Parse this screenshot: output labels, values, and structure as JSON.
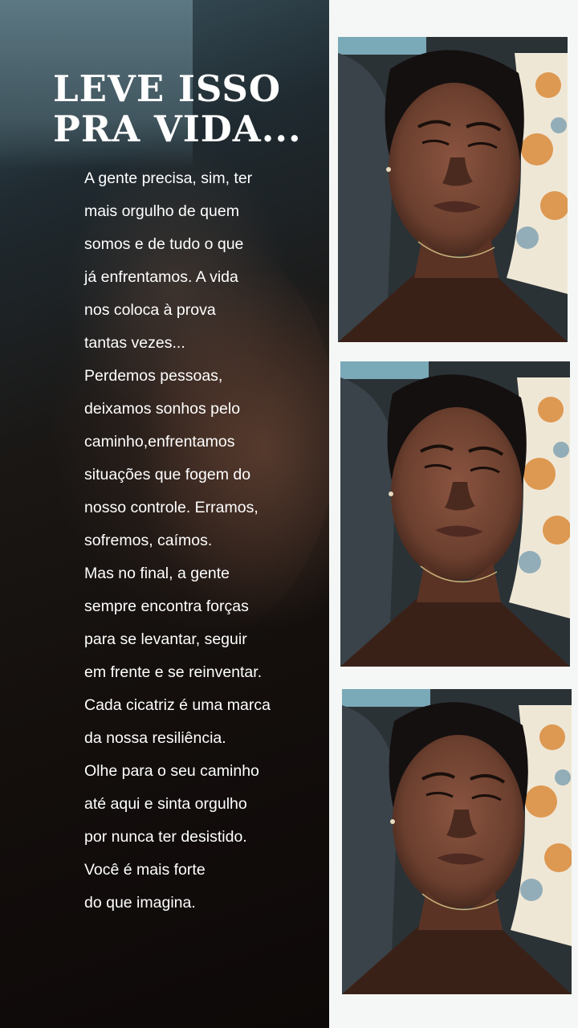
{
  "title": {
    "line1": "LEVE ISSO",
    "line2": "PRA VIDA..."
  },
  "poem": {
    "lines": [
      "A gente precisa, sim, ter",
      "mais orgulho de quem",
      "somos e de tudo o que",
      "já enfrentamos. A vida",
      "nos coloca à prova",
      "tantas vezes...",
      "Perdemos pessoas,",
      "deixamos sonhos pelo",
      "caminho,enfrentamos",
      "situações que fogem do",
      "nosso controle. Erramos,",
      "sofremos, caímos.",
      "Mas no final, a gente",
      "sempre encontra forças",
      "para se levantar, seguir",
      "em frente e se reinventar.",
      "Cada cicatriz é uma marca",
      "da nossa resiliência.",
      "Olhe para o seu caminho",
      "até aqui e sinta orgulho",
      "por nunca ter desistido.",
      "Você é mais forte",
      "do que imagina."
    ]
  },
  "colors": {
    "page_background": "#f4f7f5",
    "text": "#ffffff",
    "skin": "#6b3f2e",
    "pillow_pattern": "#d98a3a"
  }
}
